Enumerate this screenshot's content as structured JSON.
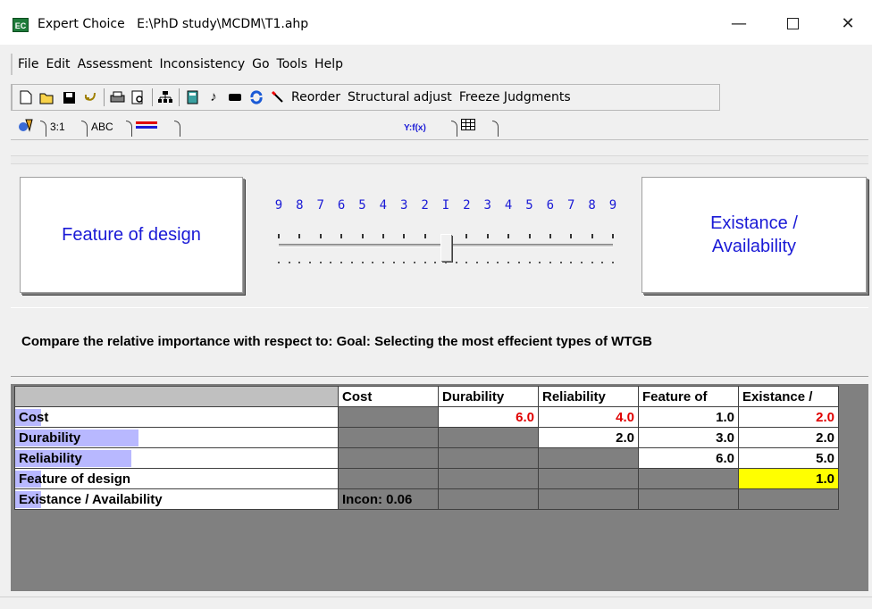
{
  "window": {
    "app_name": "Expert Choice",
    "file_path": "E:\\PhD study\\MCDM\\T1.ahp",
    "min_glyph": "—",
    "close_glyph": "✕"
  },
  "menu": [
    "File",
    "Edit",
    "Assessment",
    "Inconsistency",
    "Go",
    "Tools",
    "Help"
  ],
  "toolbar": {
    "text_buttons": [
      "Reorder",
      "Structural adjust",
      "Freeze Judgments"
    ]
  },
  "tabs": [
    "3:1",
    "ABC",
    "Y:f(x)"
  ],
  "comparison": {
    "left_item": "Feature of design",
    "right_item_line1": "Existance /",
    "right_item_line2": "Availability",
    "scale_labels": [
      "9",
      "8",
      "7",
      "6",
      "5",
      "4",
      "3",
      "2",
      "1",
      "2",
      "3",
      "4",
      "5",
      "6",
      "7",
      "8",
      "9"
    ],
    "slider_value": 1,
    "prompt": "Compare the relative importance  with respect to: Goal: Selecting the most effecient types of WTGB"
  },
  "matrix": {
    "columns": [
      "Cost",
      "Durability",
      "Reliability",
      "Feature of",
      "Existance /"
    ],
    "rows": [
      {
        "label_bold": "Co",
        "label_rest": "st",
        "bar": 0.08
      },
      {
        "label_bold": "Durability",
        "label_rest": "",
        "bar": 0.38
      },
      {
        "label_bold": "Reliability",
        "label_rest": "",
        "bar": 0.36
      },
      {
        "label_bold": "Fe",
        "label_rest": "ature of design",
        "bar": 0.08
      },
      {
        "label_bold": "Exis",
        "label_rest": "tance / Availability",
        "bar": 0.08
      }
    ],
    "values": {
      "r0c1": "6.0",
      "r0c2": "4.0",
      "r0c3": "1.0",
      "r0c4": "2.0",
      "r1c2": "2.0",
      "r1c3": "3.0",
      "r1c4": "2.0",
      "r2c3": "6.0",
      "r2c4": "5.0",
      "r3c4": "1.0"
    },
    "inconsistency": "Incon: 0.06",
    "colors": {
      "inverse": "#e00000",
      "highlight": "#ffff00",
      "bar": "#b8b8ff"
    }
  }
}
